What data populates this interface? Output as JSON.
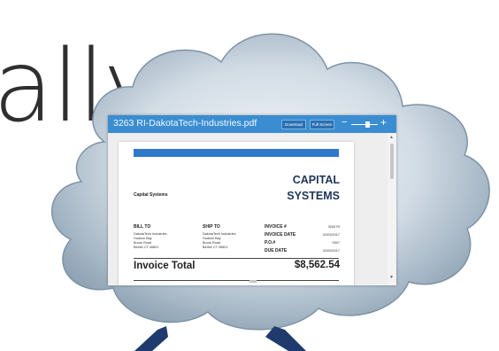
{
  "background_word": "ally",
  "viewer": {
    "filename": "3263 RI-DakotaTech-Industries.pdf",
    "download_label": "Download",
    "fullscreen_label": "Full Screen",
    "zoom_minus": "−",
    "zoom_plus": "+",
    "zoom_level": 0.6,
    "title_bar_color": "#3a8dd0"
  },
  "invoice": {
    "accent_color": "#2f78c9",
    "company_name": "Capital Systems",
    "logo_line1": "CAPITAL",
    "logo_line2": "SYSTEMS",
    "bill_to_heading": "BILL TO",
    "bill_to": [
      "DakotaTech Industries",
      "Hudson Bay",
      "Brook Road",
      "Bethel CT 06801"
    ],
    "ship_to_heading": "SHIP TO",
    "ship_to": [
      "DakotaTech Industries",
      "Hudson Bay",
      "Brook Road",
      "Bethel CT 06801"
    ],
    "invoice_no_label": "INVOICE #",
    "invoice_no": "3263 RI",
    "invoice_date_label": "INVOICE DATE",
    "invoice_date": "02/03/2017",
    "po_label": "P.O.#",
    "po": "0507",
    "due_date_label": "DUE DATE",
    "due_date": "02/09/2017",
    "total_label": "Invoice Total",
    "total_amount": "$8,562.54"
  },
  "scrollbar": {
    "up_icon": "▲",
    "down_icon": "▼"
  }
}
